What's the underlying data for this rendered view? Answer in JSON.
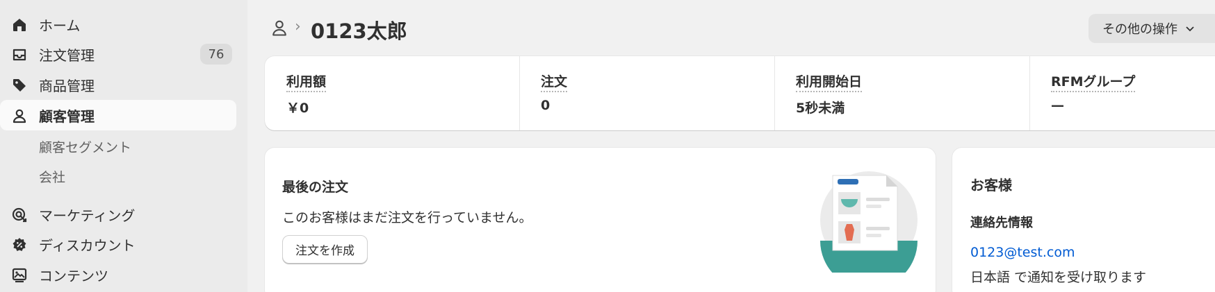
{
  "sidebar": {
    "items": [
      {
        "label": "ホーム",
        "icon": "home-icon"
      },
      {
        "label": "注文管理",
        "icon": "inbox-icon",
        "badge": "76"
      },
      {
        "label": "商品管理",
        "icon": "tag-icon"
      },
      {
        "label": "顧客管理",
        "icon": "person-icon",
        "active": true
      },
      {
        "label": "マーケティング",
        "icon": "target-icon"
      },
      {
        "label": "ディスカウント",
        "icon": "discount-icon"
      },
      {
        "label": "コンテンツ",
        "icon": "content-icon"
      }
    ],
    "sub_items": [
      {
        "label": "顧客セグメント"
      },
      {
        "label": "会社"
      }
    ]
  },
  "header": {
    "title": "0123太郎",
    "more_actions": "その他の操作"
  },
  "stats": [
    {
      "label": "利用額",
      "value": "￥0"
    },
    {
      "label": "注文",
      "value": "0"
    },
    {
      "label": "利用開始日",
      "value": "5秒未満"
    },
    {
      "label": "RFMグループ",
      "value": "—"
    }
  ],
  "last_order": {
    "title": "最後の注文",
    "description": "このお客様はまだ注文を行っていません。",
    "create_button": "注文を作成"
  },
  "customer": {
    "title": "お客様",
    "contact_title": "連絡先情報",
    "email": "0123@test.com",
    "notification": "日本語 で通知を受け取ります"
  },
  "colors": {
    "accent_link": "#005bd3",
    "sidebar_bg": "#ebebeb",
    "page_bg": "#f1f1f1",
    "illustration_teal": "#3c9e94"
  }
}
